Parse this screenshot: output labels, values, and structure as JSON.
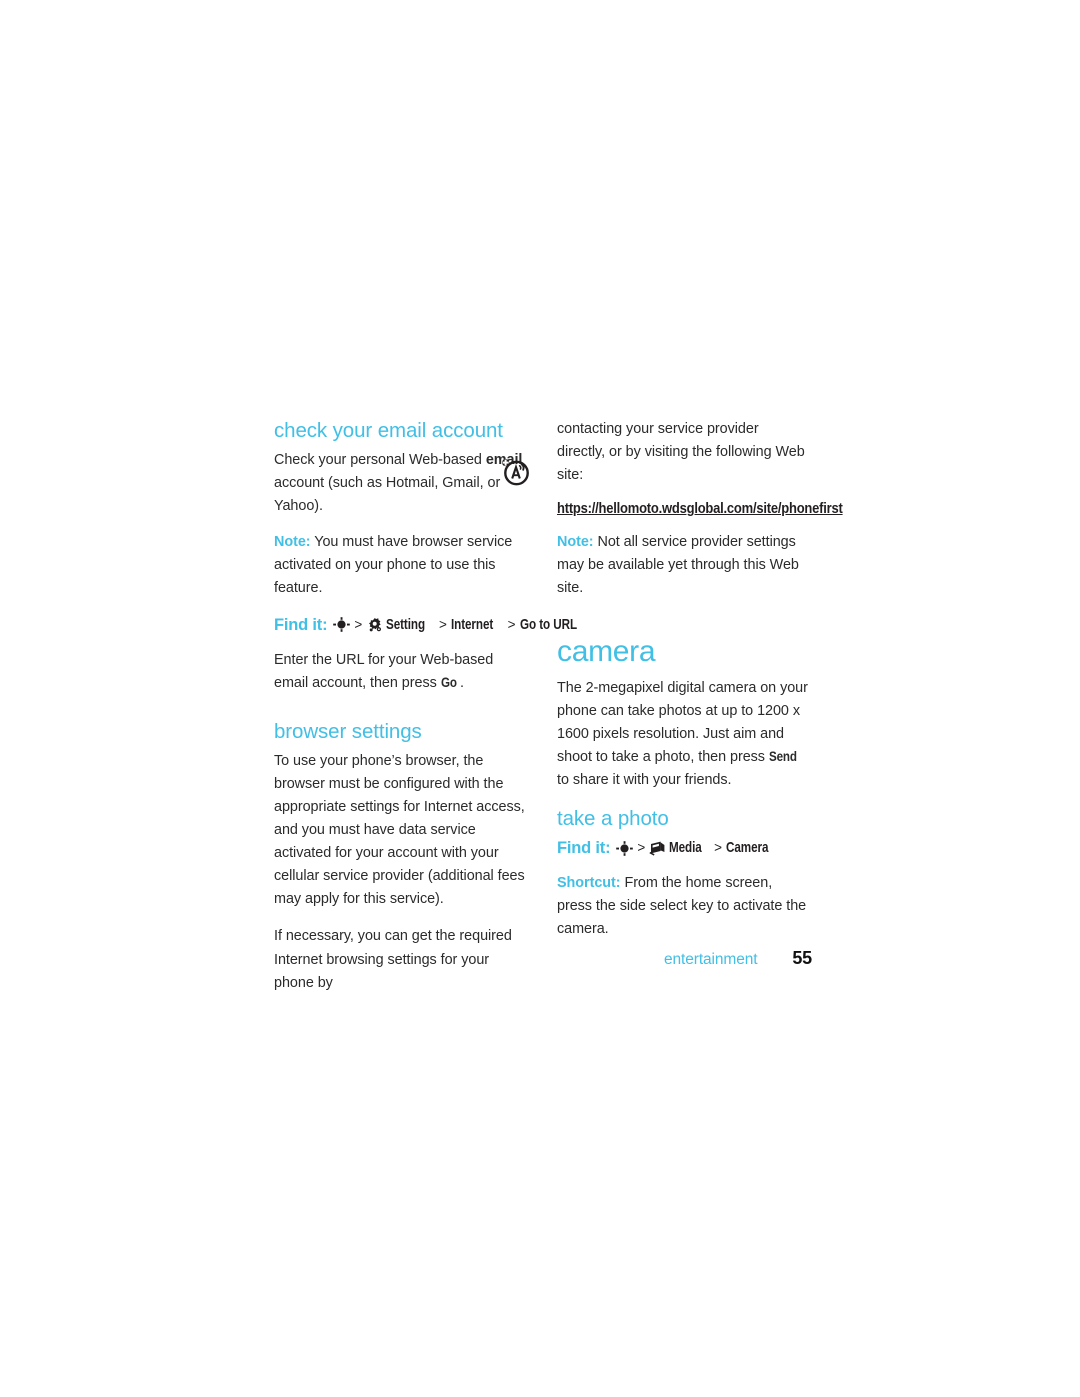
{
  "page": {
    "background": "#ffffff",
    "accent_color": "#41bfe5",
    "text_color": "#2b2b2b"
  },
  "left_column": {
    "heading_email": "check your email account",
    "para_check": {
      "before": "Check your personal Web-based ",
      "bold": "email",
      "after": " account (such as Hotmail, Gmail, or Yahoo)."
    },
    "note_browser": {
      "label": "Note:",
      "text": " You must have browser service activated on your phone to use this feature."
    },
    "find_it_url": {
      "label": "Find it:",
      "nav_icon": "nav-key-icon",
      "sep1": ">",
      "gear_icon": "gear-icon",
      "item1": "Setting",
      "sep2": ">",
      "item2": "Internet",
      "sep3": ">",
      "item3": "Go to URL"
    },
    "para_enter_url": {
      "before": "Enter the URL for your Web-based email account, then press ",
      "key": "Go",
      "after": "."
    },
    "heading_browser": "browser settings",
    "para_browser_1": "To use your phone’s browser, the browser must be configured with the appropriate settings for Internet access, and you must have data service activated for your account with your cellular service provider (additional fees may apply for this service).",
    "para_browser_2": "If necessary, you can get the required Internet browsing settings for your phone by"
  },
  "right_column": {
    "para_contacting": "contacting your service provider directly, or by visiting the following Web site:",
    "web_link": "https://hellomoto.wdsglobal.com/site/phonefirst",
    "note_settings": {
      "label": "Note:",
      "text": " Not all service provider settings may be available yet through this Web site."
    },
    "heading_camera": "camera",
    "para_camera": {
      "before": "The 2-megapixel digital camera on your phone can take photos at up to 1200 x 1600 pixels resolution. Just aim and shoot to take a photo, then press ",
      "key": "Send",
      "after": " to share it with your friends."
    },
    "heading_take_photo": "take a photo",
    "find_it_camera": {
      "label": "Find it:",
      "nav_icon": "nav-key-icon",
      "sep1": ">",
      "media_icon": "media-icon",
      "item1": "Media",
      "sep2": ">",
      "item2": "Camera"
    },
    "shortcut": {
      "label": "Shortcut:",
      "text": " From the home screen, press the side select key to activate the camera."
    }
  },
  "footer": {
    "section": "entertainment",
    "page_number": "55"
  },
  "icons": {
    "browser_badge": "browser-access-icon",
    "nav_key": "navigation-key-icon",
    "gear": "settings-gear-icon",
    "media": "media-icon"
  }
}
